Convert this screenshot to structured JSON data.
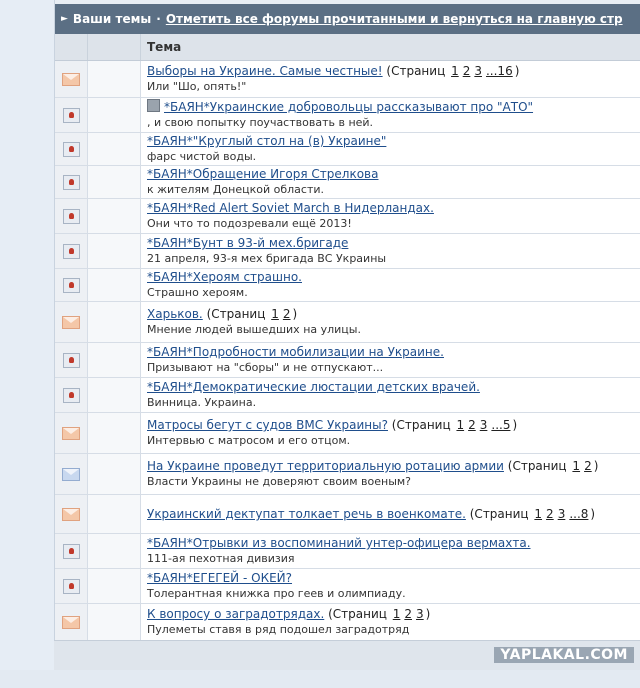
{
  "titlebar": {
    "label": "Ваши темы",
    "link": "Отметить все форумы прочитанными и вернуться на главную стр"
  },
  "table": {
    "column_topic": "Тема",
    "rows": [
      {
        "icon": "peach-envelope-icon",
        "title": "Выборы на Украине. Самые честные!",
        "pages_label": "(Страниц",
        "pages": [
          "1",
          "2",
          "3",
          "...16"
        ],
        "pages_end": ")",
        "desc": "Или \"Шо, опять!\""
      },
      {
        "icon": "closed-topic-icon",
        "pinned": true,
        "title": "*БАЯН*Украинские добровольцы рассказывают про \"АТО\"",
        "desc": ", и свою попытку поучаствовать в ней."
      },
      {
        "icon": "closed-topic-icon",
        "title": "*БАЯН*\"Круглый стол на (в) Украине\"",
        "desc": "фарс чистой воды."
      },
      {
        "icon": "closed-topic-icon",
        "title": "*БАЯН*Обращение Игоря Стрелкова",
        "desc": "к жителям Донецкой области."
      },
      {
        "icon": "closed-topic-icon",
        "title": "*БАЯН*Red Alert Soviet March в Нидерландах.",
        "desc": "Они что то подозревали ещё 2013!"
      },
      {
        "icon": "closed-topic-icon",
        "title": "*БАЯН*Бунт в 93-й мех.бригаде",
        "desc": "21 апреля, 93-я мех бригада ВС Украины"
      },
      {
        "icon": "closed-topic-icon",
        "title": "*БАЯН*Хероям страшно.",
        "desc": "Страшно хероям."
      },
      {
        "icon": "peach-envelope-icon",
        "title": "Харьков.",
        "pages_label": "(Страниц",
        "pages": [
          "1",
          "2"
        ],
        "pages_end": ")",
        "desc": "Мнение людей вышедших на улицы."
      },
      {
        "icon": "closed-topic-icon",
        "title": "*БАЯН*Подробности мобилизации на Украине.",
        "desc": "Призывают на \"сборы\" и не отпускают..."
      },
      {
        "icon": "closed-topic-icon",
        "title": "*БАЯН*Демократические люстации детских врачей.",
        "desc": "Винница. Украина."
      },
      {
        "icon": "peach-envelope-icon",
        "title": "Матросы бегут с судов ВМС Украины?",
        "pages_label": "(Страниц",
        "pages": [
          "1",
          "2",
          "3",
          "...5"
        ],
        "pages_end": ")",
        "desc": "Интервью с матросом и его отцом."
      },
      {
        "icon": "blue-envelope-icon",
        "title": "На Украине проведут территориальную ротацию армии",
        "pages_label": "(Страниц",
        "pages": [
          "1",
          "2"
        ],
        "pages_end": ")",
        "desc": "Власти Украины не доверяют своим военым?"
      },
      {
        "icon": "peach-envelope-icon",
        "title": "Украинский дектупат толкает речь в военкомате.",
        "pages_label": "(Страниц",
        "pages": [
          "1",
          "2",
          "3",
          "...8"
        ],
        "pages_end": ")",
        "desc": ""
      },
      {
        "icon": "closed-topic-icon",
        "title": "*БАЯН*Отрывки из воспоминаний унтер-офицера вермахта.",
        "desc": "111-ая пехотная дивизия"
      },
      {
        "icon": "closed-topic-icon",
        "title": "*БАЯН*ЕГЕГЕЙ - ОКЕЙ?",
        "desc": "Толерантная книжка про геев и олимпиаду."
      },
      {
        "icon": "peach-envelope-icon",
        "title": "К вопросу о заградотрядах.",
        "pages_label": "(Страниц",
        "pages": [
          "1",
          "2",
          "3"
        ],
        "pages_end": ")",
        "desc": "Пулеметы ставя в ряд подошел заградотряд"
      }
    ]
  },
  "watermark": "YAPLAKAL.COM"
}
